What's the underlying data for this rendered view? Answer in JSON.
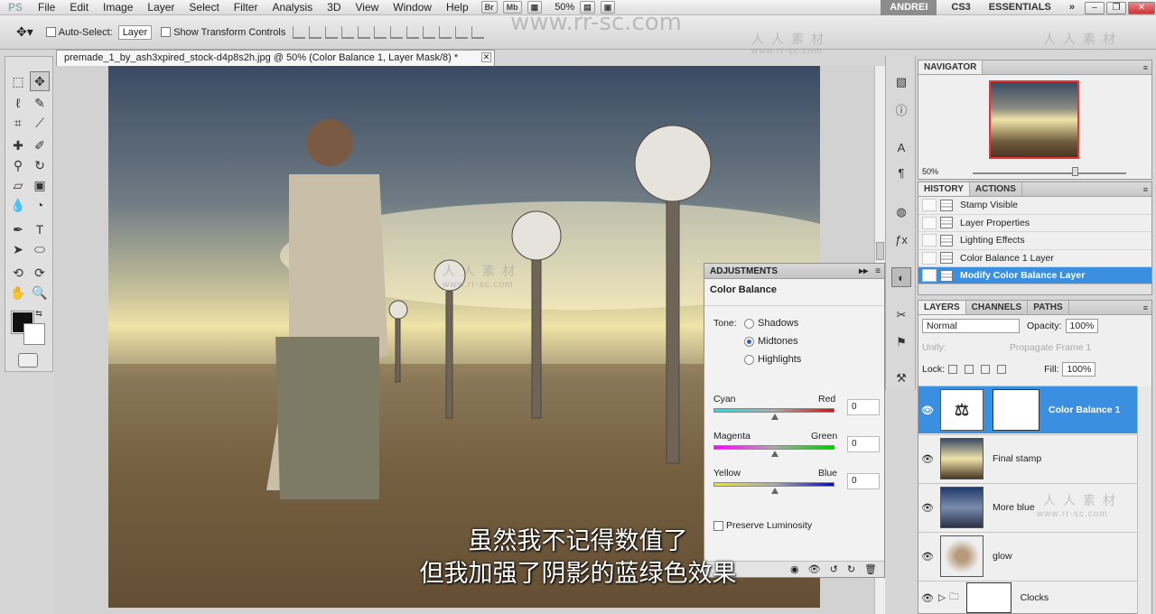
{
  "menubar": {
    "logo": "PS",
    "items": [
      "File",
      "Edit",
      "Image",
      "Layer",
      "Select",
      "Filter",
      "Analysis",
      "3D",
      "View",
      "Window",
      "Help"
    ],
    "bridge": "Br",
    "minibridge": "Mb",
    "zoom": "50%",
    "workspace_user": "ANDREI",
    "workspace_cs3": "CS3",
    "workspace_essentials": "ESSENTIALS",
    "more": "»"
  },
  "options": {
    "auto_select_label": "Auto-Select:",
    "auto_select_value": "Layer",
    "show_transform_label": "Show Transform Controls"
  },
  "document": {
    "tab_title": "premade_1_by_ash3xpired_stock-d4p8s2h.jpg @ 50% (Color Balance 1, Layer Mask/8) *"
  },
  "navigator": {
    "title": "NAVIGATOR",
    "zoom": "50%"
  },
  "history": {
    "tab_history": "HISTORY",
    "tab_actions": "ACTIONS",
    "items": [
      {
        "label": "Stamp Visible"
      },
      {
        "label": "Layer Properties"
      },
      {
        "label": "Lighting Effects"
      },
      {
        "label": "Color Balance 1 Layer"
      },
      {
        "label": "Modify Color Balance Layer"
      }
    ]
  },
  "layers": {
    "tab_layers": "LAYERS",
    "tab_channels": "CHANNELS",
    "tab_paths": "PATHS",
    "blend_mode": "Normal",
    "opacity_label": "Opacity:",
    "opacity": "100%",
    "unify_label": "Unify:",
    "propagate_label": "Propagate Frame 1",
    "lock_label": "Lock:",
    "fill_label": "Fill:",
    "fill": "100%",
    "items": [
      {
        "name": "Color Balance 1"
      },
      {
        "name": "Final stamp"
      },
      {
        "name": "More blue"
      },
      {
        "name": "glow"
      },
      {
        "name": "Clocks"
      }
    ]
  },
  "adjustments": {
    "panel_title": "ADJUSTMENTS",
    "title": "Color Balance",
    "tone_label": "Tone:",
    "tones": [
      "Shadows",
      "Midtones",
      "Highlights"
    ],
    "selected_tone": "Midtones",
    "sliders": [
      {
        "left": "Cyan",
        "right": "Red",
        "value": "0"
      },
      {
        "left": "Magenta",
        "right": "Green",
        "value": "0"
      },
      {
        "left": "Yellow",
        "right": "Blue",
        "value": "0"
      }
    ],
    "preserve_label": "Preserve Luminosity"
  },
  "subtitles": {
    "line1": "虽然我不记得数值了",
    "line2": "但我加强了阴影的蓝绿色效果"
  },
  "watermark": {
    "url_big": "www.rr-sc.com",
    "cn": "人人素材",
    "url_small": "www.rr-sc.com"
  }
}
